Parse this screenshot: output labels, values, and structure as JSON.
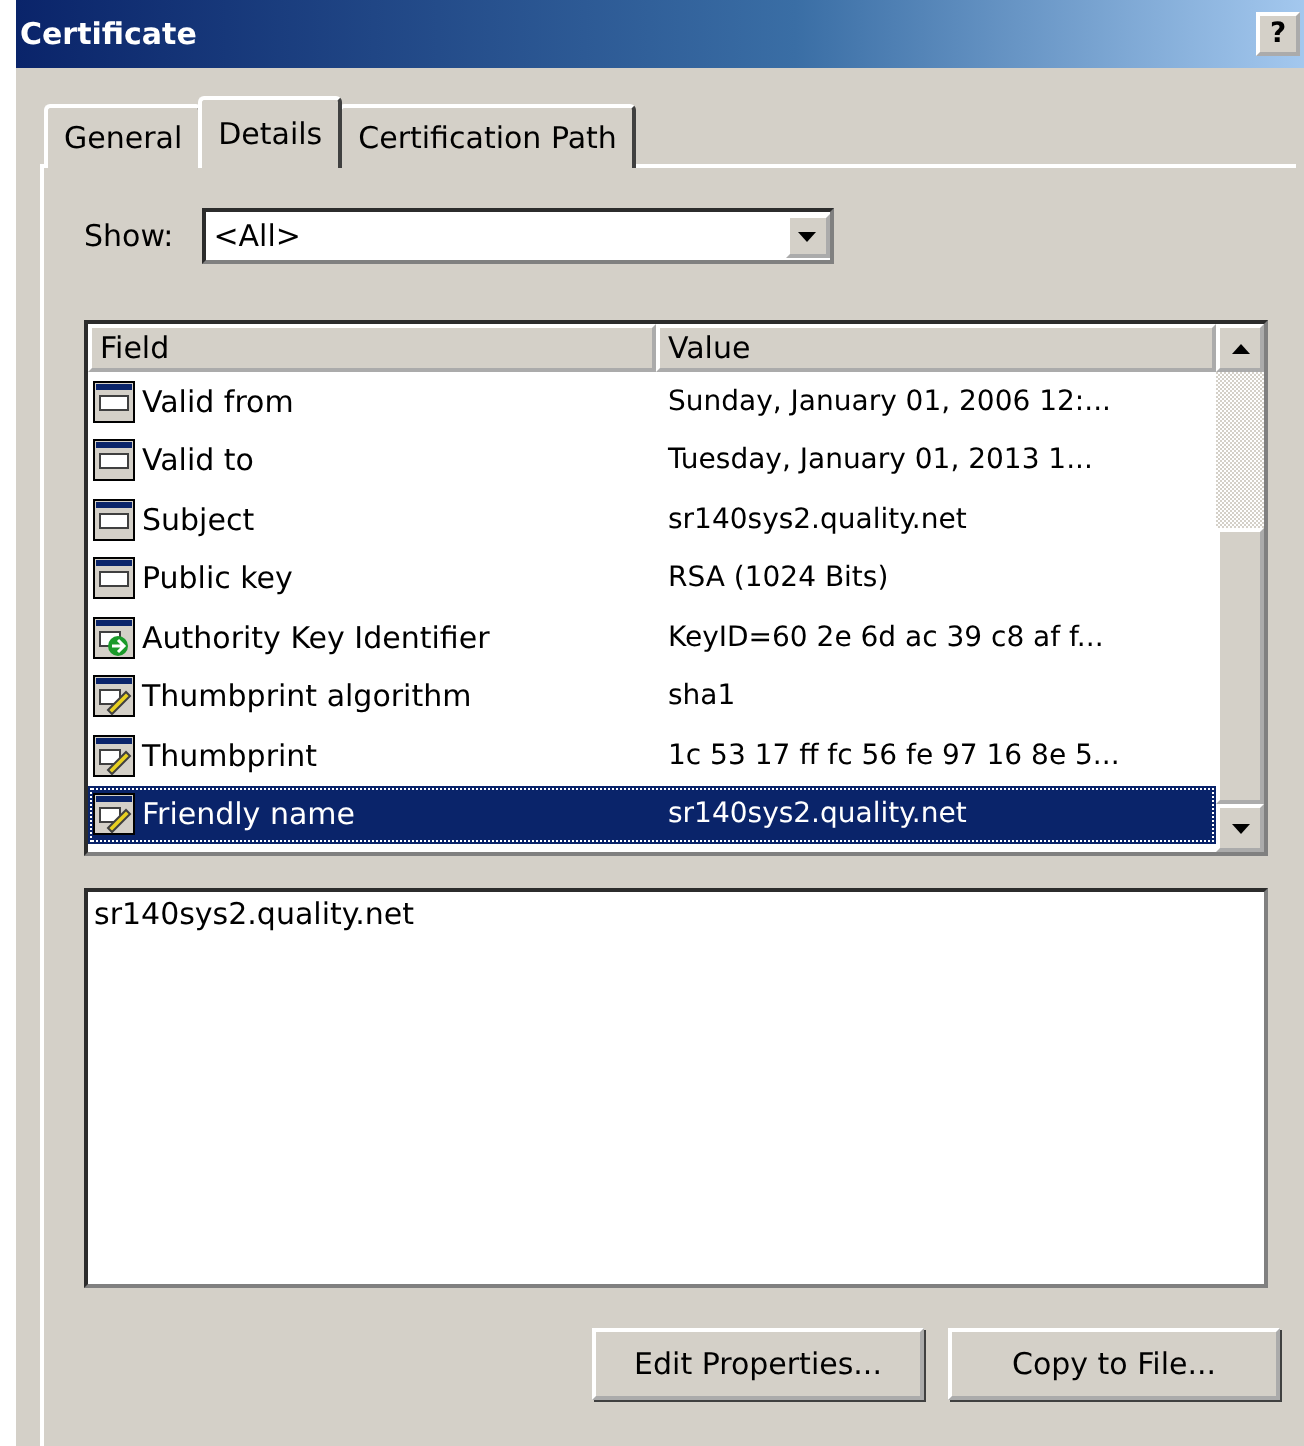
{
  "window": {
    "title": "Certificate",
    "buttons": [
      "?"
    ]
  },
  "tabs": [
    {
      "label": "General",
      "selected": false
    },
    {
      "label": "Details",
      "selected": true
    },
    {
      "label": "Certification Path",
      "selected": false
    }
  ],
  "show": {
    "label": "Show:",
    "value": "<All>"
  },
  "table": {
    "columns": [
      "Field",
      "Value"
    ],
    "rows": [
      {
        "field": "Valid from",
        "value": "Sunday, January 01, 2006 12:...",
        "kind": "field",
        "selected": false
      },
      {
        "field": "Valid to",
        "value": "Tuesday, January 01, 2013 1...",
        "kind": "field",
        "selected": false
      },
      {
        "field": "Subject",
        "value": "sr140sys2.quality.net",
        "kind": "field",
        "selected": false
      },
      {
        "field": "Public key",
        "value": "RSA (1024 Bits)",
        "kind": "field",
        "selected": false
      },
      {
        "field": "Authority Key Identifier",
        "value": "KeyID=60 2e 6d ac 39 c8 af f...",
        "kind": "extension",
        "selected": false
      },
      {
        "field": "Thumbprint algorithm",
        "value": "sha1",
        "kind": "property",
        "selected": false
      },
      {
        "field": "Thumbprint",
        "value": "1c 53 17 ff fc 56 fe 97 16 8e 5...",
        "kind": "property",
        "selected": false
      },
      {
        "field": "Friendly name",
        "value": "sr140sys2.quality.net",
        "kind": "property",
        "selected": true
      }
    ]
  },
  "detail": {
    "value": "sr140sys2.quality.net"
  },
  "buttons": [
    "Edit Properties...",
    "Copy to File..."
  ]
}
